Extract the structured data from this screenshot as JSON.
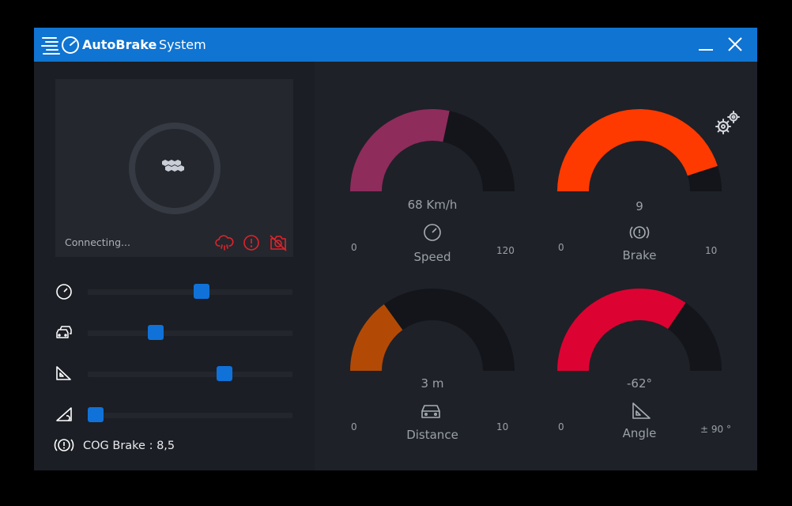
{
  "window": {
    "app_name": "AutoBrake",
    "app_subtitle": "System"
  },
  "colors": {
    "titlebar": "#0f74d2",
    "accent": "#1072d8",
    "alert": "#e0232a"
  },
  "camera": {
    "status": "Connecting...",
    "status_icons": [
      "cloud-rain-alert-icon",
      "alert-circle-icon",
      "camera-off-icon"
    ]
  },
  "sliders": [
    {
      "name": "speed",
      "icon": "speedometer-icon",
      "value": 0.56
    },
    {
      "name": "distance",
      "icon": "cars-icon",
      "value": 0.32
    },
    {
      "name": "angle",
      "icon": "triangle-ruler-icon",
      "value": 0.68
    },
    {
      "name": "slope",
      "icon": "slope-icon",
      "value": 0.0
    }
  ],
  "cog_brake": {
    "text": "COG Brake : 8,5",
    "icon": "brake-warning-icon"
  },
  "gauges": {
    "speed": {
      "value_text": "68 Km/h",
      "label": "Speed",
      "min": "0",
      "max": "120",
      "fraction": 0.567,
      "color": "#8e2c5c",
      "icon": "speedometer-icon"
    },
    "brake": {
      "value_text": "9",
      "label": "Brake",
      "min": "0",
      "max": "10",
      "fraction": 0.9,
      "color": "#ff3a00",
      "icon": "brake-warning-icon"
    },
    "distance": {
      "value_text": "3 m",
      "label": "Distance",
      "min": "0",
      "max": "10",
      "fraction": 0.3,
      "color": "#b24a06",
      "icon": "car-icon"
    },
    "angle": {
      "value_text": "-62°",
      "label": "Angle",
      "min": "0",
      "max": "± 90 °",
      "fraction": 0.69,
      "color": "#dc0332",
      "icon": "triangle-ruler-icon"
    }
  },
  "settings_icon": "gears-icon"
}
